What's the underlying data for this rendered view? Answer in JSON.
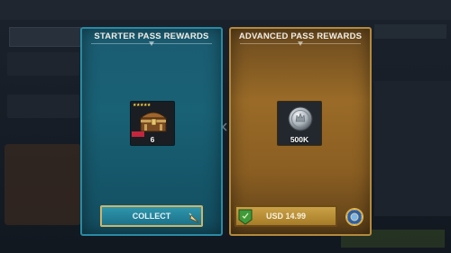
{
  "starter_card": {
    "title": "STARTER PASS REWARDS",
    "reward": {
      "icon": "treasure-chest-icon",
      "quantity": "6",
      "stars": "★★★★★"
    },
    "button_label": "COLLECT"
  },
  "advanced_card": {
    "title": "ADVANCED PASS REWARDS",
    "reward": {
      "icon": "silver-coin-icon",
      "quantity": "500K"
    },
    "button_label": "USD 14.99"
  },
  "colors": {
    "starter_card_bg": "#196175",
    "advanced_card_bg": "#9a6b28",
    "collect_button": "#2e96ad",
    "buy_button": "#caa246"
  }
}
